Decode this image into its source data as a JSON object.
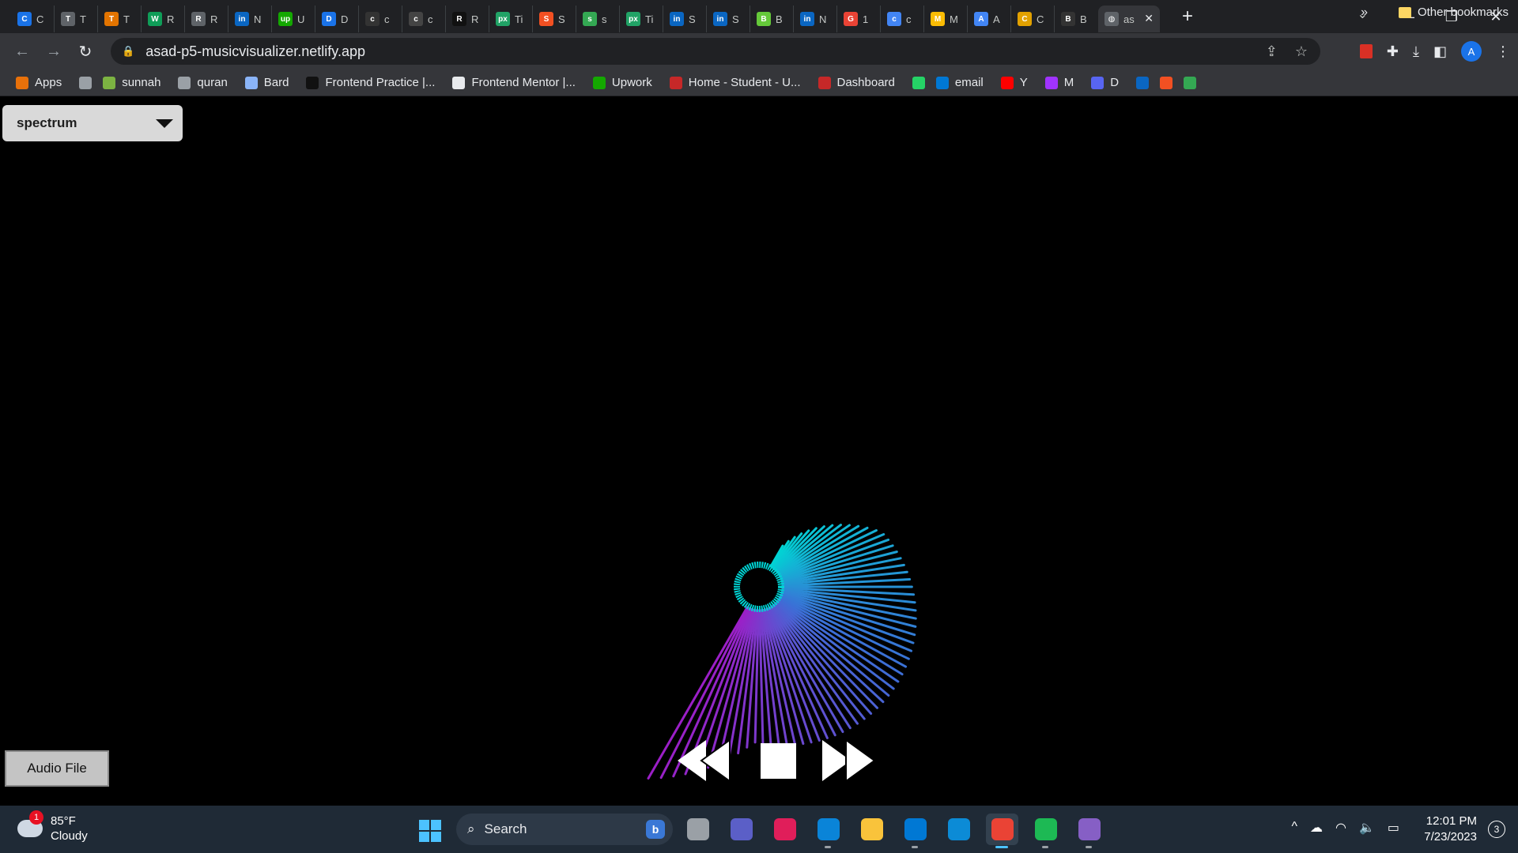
{
  "browser": {
    "tabs": [
      {
        "letter": "C",
        "title": "C",
        "color": "#1a73e8"
      },
      {
        "letter": "T",
        "title": "T",
        "color": "#5f6368"
      },
      {
        "letter": "T",
        "title": "T",
        "color": "#e37400"
      },
      {
        "letter": "W",
        "title": "R",
        "color": "#0f9d58"
      },
      {
        "letter": "R",
        "title": "R",
        "color": "#5f6368"
      },
      {
        "letter": "in",
        "title": "N",
        "color": "#0a66c2"
      },
      {
        "letter": "up",
        "title": "U",
        "color": "#14a800"
      },
      {
        "letter": "D",
        "title": "D",
        "color": "#1a73e8"
      },
      {
        "letter": "c",
        "title": "c",
        "color": "#333333"
      },
      {
        "letter": "c",
        "title": "c",
        "color": "#444444"
      },
      {
        "letter": "R",
        "title": "R",
        "color": "#111111"
      },
      {
        "letter": "px",
        "title": "Ti",
        "color": "#21a366"
      },
      {
        "letter": "S",
        "title": "S",
        "color": "#f25022"
      },
      {
        "letter": "s",
        "title": "s",
        "color": "#34a853"
      },
      {
        "letter": "px",
        "title": "Ti",
        "color": "#21a366"
      },
      {
        "letter": "in",
        "title": "S",
        "color": "#0a66c2"
      },
      {
        "letter": "in",
        "title": "S",
        "color": "#0a66c2"
      },
      {
        "letter": "B",
        "title": "B",
        "color": "#65c93a"
      },
      {
        "letter": "in",
        "title": "N",
        "color": "#0a66c2"
      },
      {
        "letter": "G",
        "title": "1",
        "color": "#ea4335"
      },
      {
        "letter": "c",
        "title": "c",
        "color": "#4285f4"
      },
      {
        "letter": "M",
        "title": "M",
        "color": "#fbbc04"
      },
      {
        "letter": "A",
        "title": "A",
        "color": "#4285f4"
      },
      {
        "letter": "C",
        "title": "C",
        "color": "#e2a100"
      },
      {
        "letter": "B",
        "title": "B",
        "color": "#333333"
      }
    ],
    "active_tab": {
      "title": "as",
      "close": "✕"
    },
    "new_tab": "+",
    "window_controls": {
      "minimize": "—",
      "restore": "❐",
      "close": "✕"
    },
    "tab_search": "⌄",
    "nav": {
      "back": "←",
      "forward": "→",
      "reload": "↻"
    },
    "url": "asad-p5-musicvisualizer.netlify.app",
    "lock": "🔒",
    "omnibox_icons": {
      "share": "⇪",
      "star": "☆"
    },
    "profile_initial": "A",
    "bookmarks": [
      {
        "label": "Apps",
        "icon": "apps-grid",
        "color": "#e8710a"
      },
      {
        "label": "",
        "icon": "image",
        "color": "#9aa0a6"
      },
      {
        "label": "sunnah",
        "icon": "globe",
        "color": "#7cb342"
      },
      {
        "label": "quran",
        "icon": "globe",
        "color": "#9aa0a6"
      },
      {
        "label": "Bard",
        "icon": "sparkle",
        "color": "#8ab4f8"
      },
      {
        "label": "Frontend Practice |...",
        "icon": "FP",
        "color": "#111111"
      },
      {
        "label": "Frontend Mentor |...",
        "icon": "doc",
        "color": "#e8eaed"
      },
      {
        "label": "Upwork",
        "icon": "up",
        "color": "#14a800"
      },
      {
        "label": "Home - Student - U...",
        "icon": "crest",
        "color": "#c62828"
      },
      {
        "label": "Dashboard",
        "icon": "crest",
        "color": "#c62828"
      },
      {
        "label": "",
        "icon": "whatsapp",
        "color": "#25d366"
      },
      {
        "label": "email",
        "icon": "outlook",
        "color": "#0078d4"
      },
      {
        "label": "Y",
        "icon": "youtube",
        "color": "#ff0000"
      },
      {
        "label": "M",
        "icon": "messenger",
        "color": "#a033ff"
      },
      {
        "label": "D",
        "icon": "discord",
        "color": "#5865f2"
      },
      {
        "label": "",
        "icon": "ms",
        "color": "#0a66c2"
      },
      {
        "label": "",
        "icon": "sketch",
        "color": "#f25022"
      },
      {
        "label": "",
        "icon": "pinwheel",
        "color": "#34a853"
      }
    ],
    "bookmarks_more": "»",
    "other_bookmarks": "Other bookmarks"
  },
  "page": {
    "mode_select": {
      "value": "spectrum"
    },
    "audio_button": "Audio File",
    "controls": [
      "rewind",
      "stop",
      "fast-forward"
    ],
    "visual_colors": {
      "start": "#00d4d4",
      "mid": "#3b6fd6",
      "end": "#9b1fc7"
    }
  },
  "taskbar": {
    "weather": {
      "temp": "85°F",
      "condition": "Cloudy",
      "badge": "1"
    },
    "search_placeholder": "Search",
    "apps": [
      {
        "name": "task-view",
        "color": "#9aa0a6",
        "running": false,
        "active": false
      },
      {
        "name": "chat",
        "color": "#5b5fc7",
        "running": false,
        "active": false
      },
      {
        "name": "slack",
        "color": "#e01e5a",
        "running": false,
        "active": false
      },
      {
        "name": "vscode",
        "color": "#0a84d8",
        "running": true,
        "active": false
      },
      {
        "name": "file-explorer",
        "color": "#f9c33b",
        "running": false,
        "active": false
      },
      {
        "name": "mail",
        "color": "#0078d4",
        "running": true,
        "active": false
      },
      {
        "name": "edge",
        "color": "#0c8bd6",
        "running": false,
        "active": false
      },
      {
        "name": "chrome",
        "color": "#ea4335",
        "running": true,
        "active": true
      },
      {
        "name": "spotify",
        "color": "#1db954",
        "running": true,
        "active": false
      },
      {
        "name": "visual-studio",
        "color": "#865fc5",
        "running": true,
        "active": false
      }
    ],
    "tray": {
      "chevron": "^",
      "cloud": "☁",
      "wifi": "◠",
      "volume": "🔈",
      "battery": "▭"
    },
    "time": "12:01 PM",
    "date": "7/23/2023",
    "notifications": "3"
  }
}
